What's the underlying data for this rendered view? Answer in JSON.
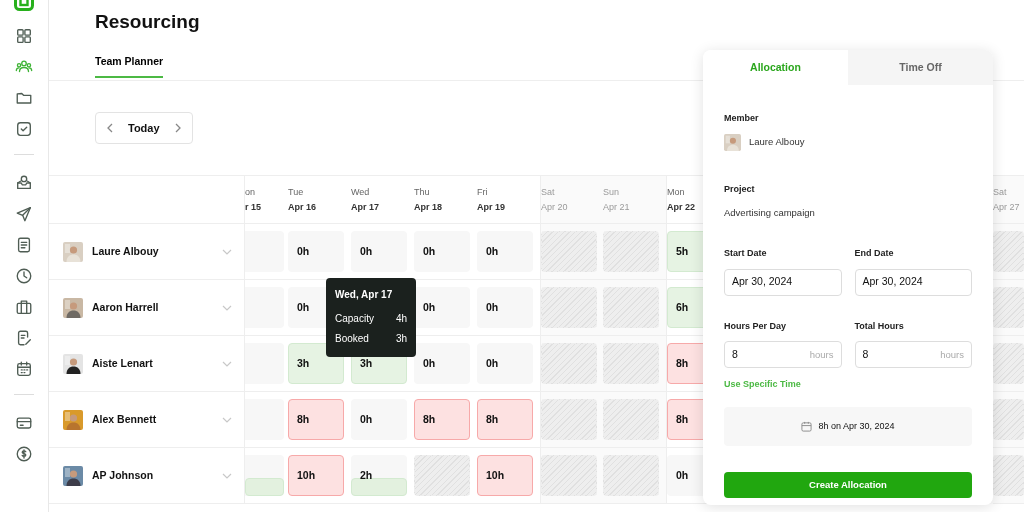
{
  "sidebar": {
    "groups": [
      {
        "items": [
          {
            "selected": false
          },
          {
            "selected": true
          },
          {
            "selected": false
          },
          {
            "selected": false
          }
        ]
      },
      {
        "items": [
          {
            "selected": false
          },
          {
            "selected": false
          },
          {
            "selected": false
          },
          {
            "selected": false
          },
          {
            "selected": false
          },
          {
            "selected": false
          },
          {
            "selected": false
          }
        ]
      },
      {
        "items": [
          {
            "selected": false
          },
          {
            "selected": false
          }
        ]
      }
    ]
  },
  "header": {
    "title": "Resourcing",
    "tabs": [
      {
        "label": "Team Planner",
        "selected": true
      }
    ]
  },
  "navigator": {
    "label": "Today"
  },
  "days": [
    {
      "weekday": "on",
      "date": "r 15",
      "weekend": false
    },
    {
      "weekday": "Tue",
      "date": "Apr 16",
      "weekend": false
    },
    {
      "weekday": "Wed",
      "date": "Apr 17",
      "weekend": false
    },
    {
      "weekday": "Thu",
      "date": "Apr 18",
      "weekend": false
    },
    {
      "weekday": "Fri",
      "date": "Apr 19",
      "weekend": false
    },
    {
      "weekday": "Sat",
      "date": "Apr 20",
      "weekend": true
    },
    {
      "weekday": "Sun",
      "date": "Apr 21",
      "weekend": true
    },
    {
      "weekday": "Mon",
      "date": "Apr 22",
      "weekend": false
    },
    {
      "weekday": "Sat",
      "date": "Apr 27",
      "weekend": true
    }
  ],
  "members": [
    {
      "name": "Laure Albouy",
      "cells": [
        {
          "kind": "empty"
        },
        {
          "kind": "normal",
          "text": "0h"
        },
        {
          "kind": "normal",
          "text": "0h"
        },
        {
          "kind": "normal",
          "text": "0h"
        },
        {
          "kind": "normal",
          "text": "0h"
        },
        {
          "kind": "blocked"
        },
        {
          "kind": "blocked"
        },
        {
          "kind": "under",
          "text": "5h"
        },
        {
          "kind": "blocked"
        }
      ]
    },
    {
      "name": "Aaron Harrell",
      "cells": [
        {
          "kind": "empty"
        },
        {
          "kind": "normal",
          "text": "0h"
        },
        {
          "kind": "covered"
        },
        {
          "kind": "normal",
          "text": "0h"
        },
        {
          "kind": "normal",
          "text": "0h"
        },
        {
          "kind": "blocked"
        },
        {
          "kind": "blocked"
        },
        {
          "kind": "under",
          "text": "6h"
        },
        {
          "kind": "blocked"
        }
      ]
    },
    {
      "name": "Aiste Lenart",
      "cells": [
        {
          "kind": "empty"
        },
        {
          "kind": "under",
          "text": "3h"
        },
        {
          "kind": "under",
          "text": "3h"
        },
        {
          "kind": "normal",
          "text": "0h"
        },
        {
          "kind": "normal",
          "text": "0h"
        },
        {
          "kind": "blocked"
        },
        {
          "kind": "blocked"
        },
        {
          "kind": "over",
          "text": "8h"
        },
        {
          "kind": "blocked"
        }
      ]
    },
    {
      "name": "Alex Bennett",
      "cells": [
        {
          "kind": "empty"
        },
        {
          "kind": "over",
          "text": "8h"
        },
        {
          "kind": "normal",
          "text": "0h"
        },
        {
          "kind": "over",
          "text": "8h"
        },
        {
          "kind": "over",
          "text": "8h"
        },
        {
          "kind": "blocked"
        },
        {
          "kind": "blocked"
        },
        {
          "kind": "over",
          "text": "8h"
        },
        {
          "kind": "blocked"
        }
      ]
    },
    {
      "name": "AP Johnson",
      "cells": [
        {
          "kind": "partial"
        },
        {
          "kind": "over",
          "text": "10h"
        },
        {
          "kind": "partial",
          "text": "2h"
        },
        {
          "kind": "blocked"
        },
        {
          "kind": "over",
          "text": "10h"
        },
        {
          "kind": "blocked"
        },
        {
          "kind": "blocked"
        },
        {
          "kind": "normal",
          "text": "0h"
        },
        {
          "kind": "blocked"
        }
      ]
    }
  ],
  "tooltip": {
    "title": "Wed, Apr 17",
    "rows": [
      {
        "label": "Capacity",
        "value": "4h"
      },
      {
        "label": "Booked",
        "value": "3h"
      }
    ]
  },
  "panel": {
    "tabs": [
      {
        "label": "Allocation",
        "selected": true
      },
      {
        "label": "Time Off",
        "selected": false
      }
    ],
    "member_label": "Member",
    "member": "Laure Albouy",
    "project_label": "Project",
    "project": "Advertising campaign",
    "fields": [
      {
        "label": "Start Date",
        "value": "Apr 30, 2024"
      },
      {
        "label": "End Date",
        "value": "Apr 30, 2024"
      },
      {
        "label": "Hours Per Day",
        "value": "8",
        "unit": "hours"
      },
      {
        "label": "Total Hours",
        "value": "8",
        "unit": "hours"
      }
    ],
    "link": "Use Specific Time",
    "summary": "8h on Apr 30, 2024",
    "button": "Create Allocation"
  }
}
